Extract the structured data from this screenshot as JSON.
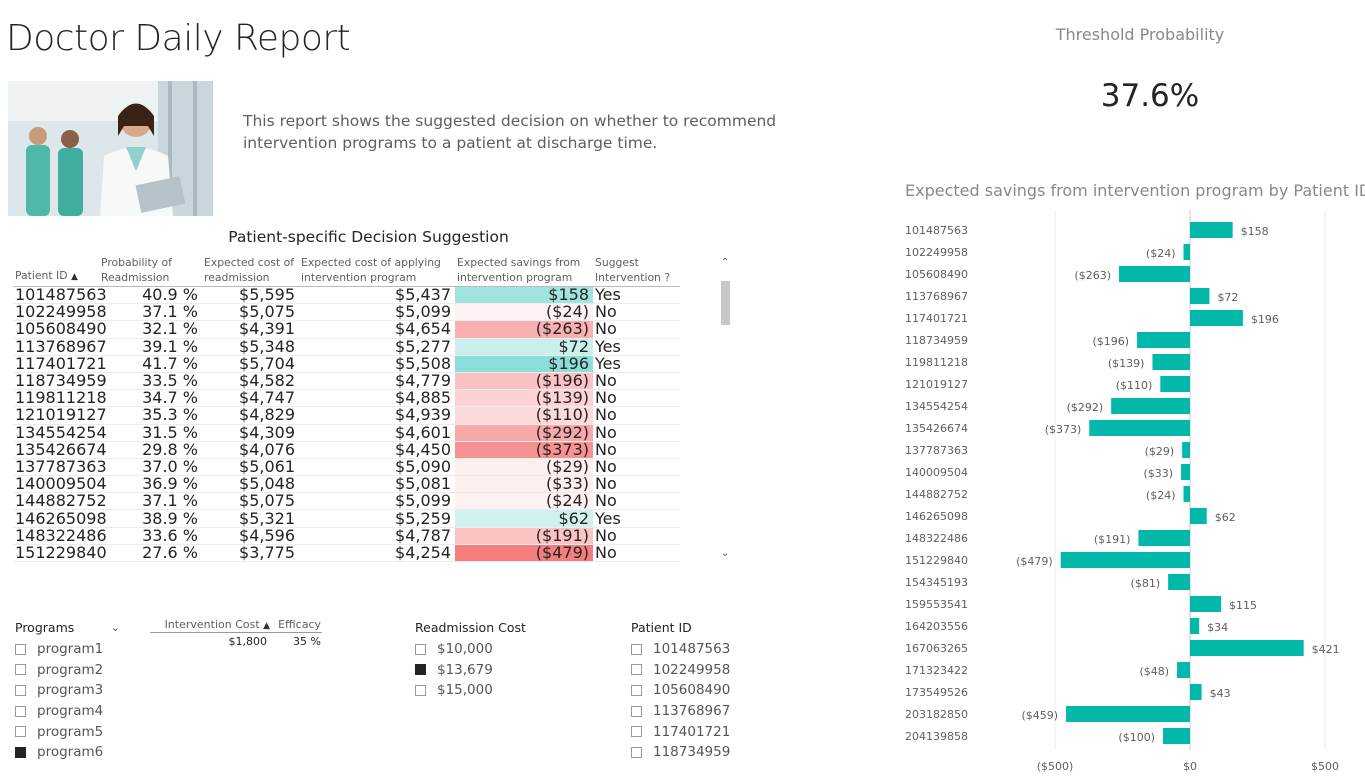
{
  "report": {
    "title": "Doctor Daily Report",
    "description": "This report shows the suggested decision on whether to recommend intervention programs to a patient at discharge time.",
    "table_title": "Patient-specific Decision Suggestion"
  },
  "table": {
    "headers": [
      "Patient ID",
      "Probability of Readmission",
      "Expected cost of readmission",
      "Expected cost of applying intervention program",
      "Expected savings from intervention program",
      "Suggest Intervention ?"
    ],
    "rows": [
      {
        "id": "101487563",
        "prob": "40.9 %",
        "cost": "$5,595",
        "apply": "$5,437",
        "savings": "$158",
        "s": 158,
        "suggest": "Yes"
      },
      {
        "id": "102249958",
        "prob": "37.1 %",
        "cost": "$5,075",
        "apply": "$5,099",
        "savings": "($24)",
        "s": -24,
        "suggest": "No"
      },
      {
        "id": "105608490",
        "prob": "32.1 %",
        "cost": "$4,391",
        "apply": "$4,654",
        "savings": "($263)",
        "s": -263,
        "suggest": "No"
      },
      {
        "id": "113768967",
        "prob": "39.1 %",
        "cost": "$5,348",
        "apply": "$5,277",
        "savings": "$72",
        "s": 72,
        "suggest": "Yes"
      },
      {
        "id": "117401721",
        "prob": "41.7 %",
        "cost": "$5,704",
        "apply": "$5,508",
        "savings": "$196",
        "s": 196,
        "suggest": "Yes"
      },
      {
        "id": "118734959",
        "prob": "33.5 %",
        "cost": "$4,582",
        "apply": "$4,779",
        "savings": "($196)",
        "s": -196,
        "suggest": "No"
      },
      {
        "id": "119811218",
        "prob": "34.7 %",
        "cost": "$4,747",
        "apply": "$4,885",
        "savings": "($139)",
        "s": -139,
        "suggest": "No"
      },
      {
        "id": "121019127",
        "prob": "35.3 %",
        "cost": "$4,829",
        "apply": "$4,939",
        "savings": "($110)",
        "s": -110,
        "suggest": "No"
      },
      {
        "id": "134554254",
        "prob": "31.5 %",
        "cost": "$4,309",
        "apply": "$4,601",
        "savings": "($292)",
        "s": -292,
        "suggest": "No"
      },
      {
        "id": "135426674",
        "prob": "29.8 %",
        "cost": "$4,076",
        "apply": "$4,450",
        "savings": "($373)",
        "s": -373,
        "suggest": "No"
      },
      {
        "id": "137787363",
        "prob": "37.0 %",
        "cost": "$5,061",
        "apply": "$5,090",
        "savings": "($29)",
        "s": -29,
        "suggest": "No"
      },
      {
        "id": "140009504",
        "prob": "36.9 %",
        "cost": "$5,048",
        "apply": "$5,081",
        "savings": "($33)",
        "s": -33,
        "suggest": "No"
      },
      {
        "id": "144882752",
        "prob": "37.1 %",
        "cost": "$5,075",
        "apply": "$5,099",
        "savings": "($24)",
        "s": -24,
        "suggest": "No"
      },
      {
        "id": "146265098",
        "prob": "38.9 %",
        "cost": "$5,321",
        "apply": "$5,259",
        "savings": "$62",
        "s": 62,
        "suggest": "Yes"
      },
      {
        "id": "148322486",
        "prob": "33.6 %",
        "cost": "$4,596",
        "apply": "$4,787",
        "savings": "($191)",
        "s": -191,
        "suggest": "No"
      },
      {
        "id": "151229840",
        "prob": "27.6 %",
        "cost": "$3,775",
        "apply": "$4,254",
        "savings": "($479)",
        "s": -479,
        "suggest": "No"
      }
    ]
  },
  "slicers": {
    "programs": {
      "title": "Programs",
      "items": [
        "program1",
        "program2",
        "program3",
        "program4",
        "program5",
        "program6"
      ],
      "selected": [
        5
      ]
    },
    "program_table": {
      "headers": [
        "Intervention Cost",
        "Efficacy"
      ],
      "row": [
        "$1,800",
        "35 %"
      ]
    },
    "readmission": {
      "title": "Readmission Cost",
      "items": [
        "$10,000",
        "$13,679",
        "$15,000"
      ],
      "selected": [
        1
      ]
    },
    "patients": {
      "title": "Patient ID",
      "items": [
        "101487563",
        "102249958",
        "105608490",
        "113768967",
        "117401721",
        "118734959"
      ],
      "selected": []
    }
  },
  "kpi": {
    "label": "Threshold Probability",
    "value": "37.6%"
  },
  "chart_title": "Expected savings from intervention program by Patient ID",
  "chart_data": {
    "type": "bar",
    "orientation": "horizontal",
    "categories": [
      "101487563",
      "102249958",
      "105608490",
      "113768967",
      "117401721",
      "118734959",
      "119811218",
      "121019127",
      "134554254",
      "135426674",
      "137787363",
      "140009504",
      "144882752",
      "146265098",
      "148322486",
      "151229840",
      "154345193",
      "159553541",
      "164203556",
      "167063265",
      "171323422",
      "173549526",
      "203182850",
      "204139858"
    ],
    "values": [
      158,
      -24,
      -263,
      72,
      196,
      -196,
      -139,
      -110,
      -292,
      -373,
      -29,
      -33,
      -24,
      62,
      -191,
      -479,
      -81,
      115,
      34,
      421,
      -48,
      43,
      -459,
      -100
    ],
    "labels": [
      "$158",
      "($24)",
      "($263)",
      "$72",
      "$196",
      "($196)",
      "($139)",
      "($110)",
      "($292)",
      "($373)",
      "($29)",
      "($33)",
      "($24)",
      "$62",
      "($191)",
      "($479)",
      "($81)",
      "$115",
      "$34",
      "$421",
      "($48)",
      "$43",
      "($459)",
      "($100)"
    ],
    "xlim": [
      -500,
      500
    ],
    "xticks": [
      "($500)",
      "$0",
      "$500"
    ],
    "color": "#01b8aa"
  }
}
